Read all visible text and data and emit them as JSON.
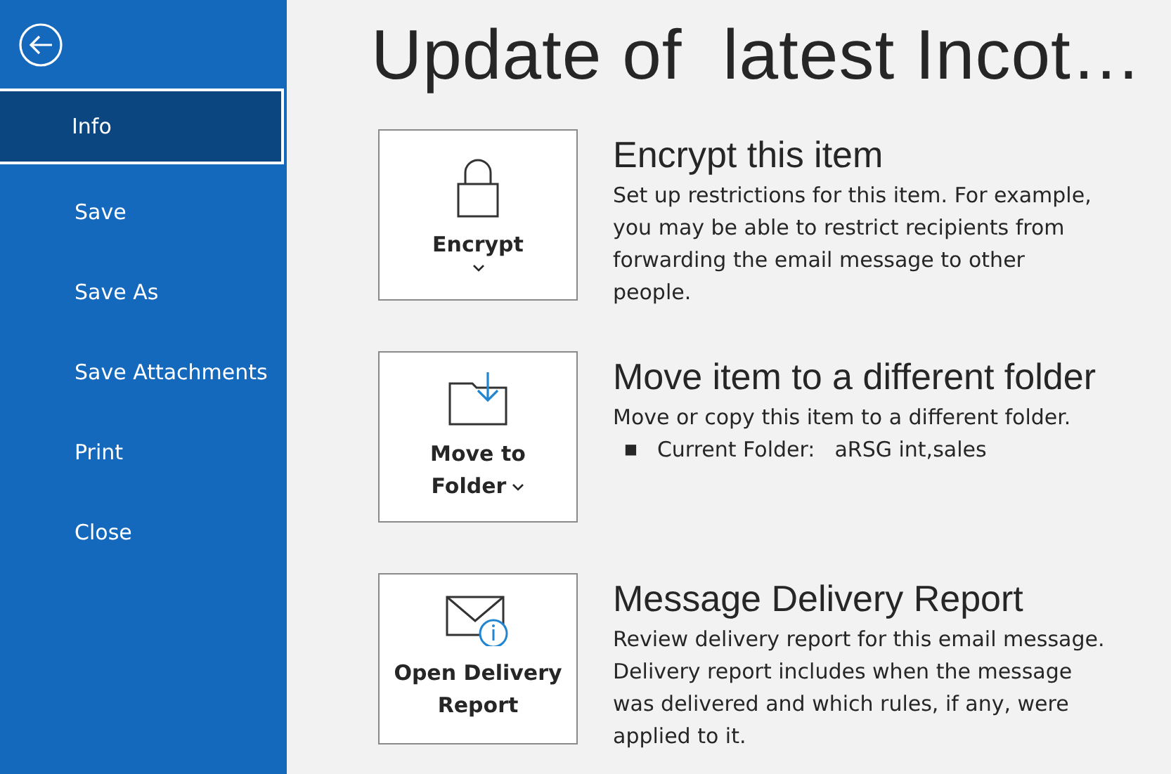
{
  "sidebar": {
    "items": [
      {
        "label": "Info",
        "selected": true
      },
      {
        "label": "Save",
        "selected": false
      },
      {
        "label": "Save As",
        "selected": false
      },
      {
        "label": "Save Attachments",
        "selected": false
      },
      {
        "label": "Print",
        "selected": false
      },
      {
        "label": "Close",
        "selected": false
      }
    ]
  },
  "title": "Update of  latest Incot…",
  "sections": [
    {
      "kind": "encrypt",
      "button_lines": [
        "Encrypt"
      ],
      "heading": "Encrypt this item",
      "description": "Set up restrictions for this item. For example, you may be able to restrict recipients from forwarding the email message to other people."
    },
    {
      "kind": "move",
      "button_lines": [
        "Move to",
        "Folder"
      ],
      "heading": "Move item to a different folder",
      "description": "Move or copy this item to a different folder.",
      "bullet": {
        "marker": "■",
        "label": "Current Folder:",
        "value": "aRSG int,sales"
      }
    },
    {
      "kind": "report",
      "button_lines": [
        "Open Delivery",
        "Report"
      ],
      "heading": "Message Delivery Report",
      "description": "Review delivery report for this email message. Delivery report includes when the message was delivered and which rules, if any, were applied to it."
    }
  ]
}
